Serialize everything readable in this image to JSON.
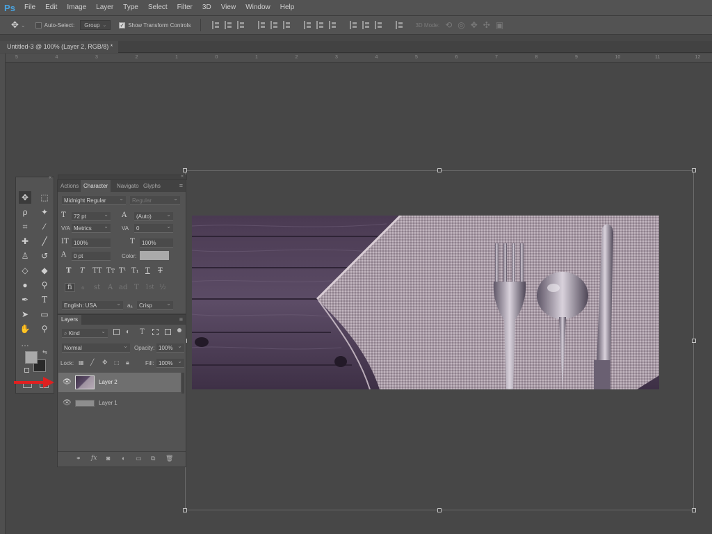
{
  "app": {
    "logo": "Ps"
  },
  "menu": [
    "File",
    "Edit",
    "Image",
    "Layer",
    "Type",
    "Select",
    "Filter",
    "3D",
    "View",
    "Window",
    "Help"
  ],
  "options": {
    "auto_select_label": "Auto-Select:",
    "auto_select_value": "Group",
    "show_transform_label": "Show Transform Controls",
    "mode_3d_label": "3D Mode:"
  },
  "document": {
    "tab_title": "Untitled-3 @ 100% (Layer 2, RGB/8) *"
  },
  "ruler_top_ticks": [
    "5",
    "4",
    "3",
    "2",
    "1",
    "0",
    "1",
    "2",
    "3",
    "4",
    "5",
    "6",
    "7",
    "8",
    "9",
    "10",
    "11",
    "12"
  ],
  "character_panel": {
    "tabs": [
      "Actions",
      "Character",
      "Navigato",
      "Glyphs"
    ],
    "font_family": "Midnight Regular",
    "font_style": "Regular",
    "font_size": "72 pt",
    "leading": "(Auto)",
    "kerning": "Metrics",
    "tracking": "0",
    "vertical_scale": "100%",
    "horizontal_scale": "100%",
    "baseline_shift": "0 pt",
    "color_label": "Color:",
    "color_value": "#aaaaaa",
    "type_style_buttons": [
      "T",
      "T",
      "TT",
      "Tт",
      "T¹",
      "T₁",
      "T",
      "T"
    ],
    "opentype_buttons": [
      "fi",
      "ℴ",
      "st",
      "A",
      "ad",
      "T",
      "1st",
      "½"
    ],
    "language": "English: USA",
    "aa_label": "aₐ",
    "antialias": "Crisp"
  },
  "layers_panel": {
    "tab": "Layers",
    "filter_kind": "Kind",
    "blend_mode": "Normal",
    "opacity_label": "Opacity:",
    "opacity_value": "100%",
    "lock_label": "Lock:",
    "fill_label": "Fill:",
    "fill_value": "100%",
    "layers": [
      {
        "name": "Layer 2",
        "selected": true
      },
      {
        "name": "Layer 1",
        "selected": false
      }
    ],
    "footer_icons": [
      "link-icon",
      "fx-icon",
      "mask-icon",
      "adjustment-icon",
      "folder-icon",
      "new-layer-icon",
      "trash-icon"
    ]
  },
  "colors": {
    "ui_bg": "#474747",
    "panel_bg": "#535353",
    "selected_layer": "#6f6f6f",
    "arrow": "#e02020",
    "ps_blue": "#4aa3df"
  }
}
